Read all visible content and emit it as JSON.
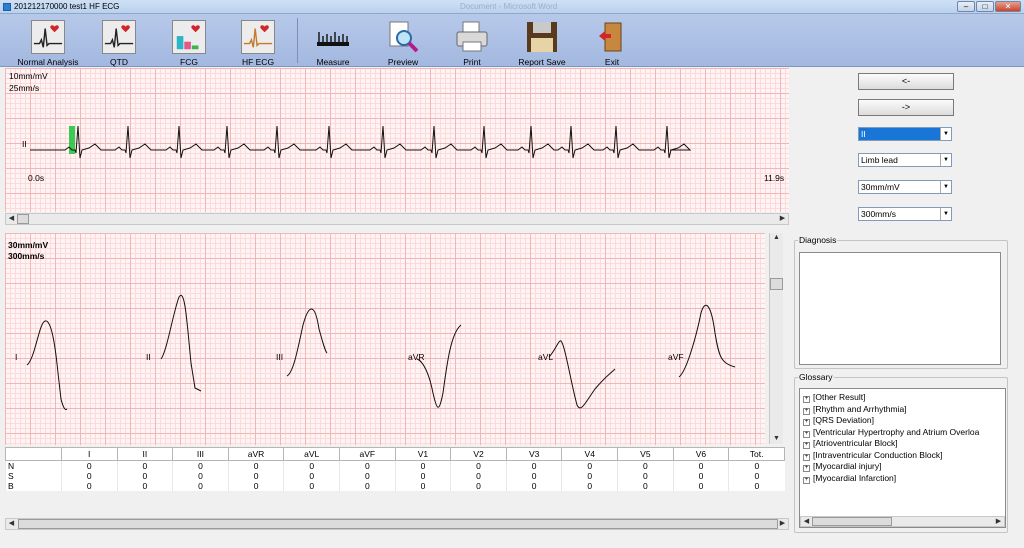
{
  "window": {
    "title": "201212170000  test1  HF ECG",
    "ghost_title": "Document - Microsoft Word",
    "controls": {
      "minimize": "–",
      "maximize": "□",
      "close": "✕"
    }
  },
  "toolbar": {
    "buttons": [
      {
        "label": "Normal Analysis",
        "icon": "ecg-heart-icon"
      },
      {
        "label": "QTD",
        "icon": "ecg-heart-icon"
      },
      {
        "label": "FCG",
        "icon": "chart-heart-icon"
      },
      {
        "label": "HF ECG",
        "icon": "ecg-heart-icon"
      },
      {
        "label": "Measure",
        "icon": "ruler-icon"
      },
      {
        "label": "Preview",
        "icon": "magnifier-icon"
      },
      {
        "label": "Print",
        "icon": "printer-icon"
      },
      {
        "label": "Report Save",
        "icon": "floppy-disk-icon"
      },
      {
        "label": "Exit",
        "icon": "exit-door-icon"
      }
    ]
  },
  "rhythm_strip": {
    "gain": "10mm/mV",
    "speed": "25mm/s",
    "lead": "II",
    "start_time": "0.0s",
    "end_time": "11.9s"
  },
  "leads_panel": {
    "gain": "30mm/mV",
    "speed": "300mm/s",
    "leads": [
      "I",
      "II",
      "III",
      "aVR",
      "aVL",
      "aVF"
    ]
  },
  "results_table": {
    "headers": [
      "",
      "I",
      "II",
      "III",
      "aVR",
      "aVL",
      "aVF",
      "V1",
      "V2",
      "V3",
      "V4",
      "V5",
      "V6",
      "Tot."
    ],
    "rows": [
      [
        "N",
        "0",
        "0",
        "0",
        "0",
        "0",
        "0",
        "0",
        "0",
        "0",
        "0",
        "0",
        "0",
        "0"
      ],
      [
        "S",
        "0",
        "0",
        "0",
        "0",
        "0",
        "0",
        "0",
        "0",
        "0",
        "0",
        "0",
        "0",
        "0"
      ],
      [
        "B",
        "0",
        "0",
        "0",
        "0",
        "0",
        "0",
        "0",
        "0",
        "0",
        "0",
        "0",
        "0",
        "0"
      ]
    ]
  },
  "controls": {
    "prev_label": "<-",
    "next_label": "->",
    "lead_select": "II",
    "lead_type_select": "Limb lead",
    "gain_select": "30mm/mV",
    "speed_select": "300mm/s",
    "dropdown_arrow": "▼"
  },
  "diagnosis": {
    "label": "Diagnosis",
    "text": ""
  },
  "glossary": {
    "label": "Glossary",
    "items": [
      "[Other Result]",
      "[Rhythm and Arrhythmia]",
      "[QRS Deviation]",
      "[Ventricular Hypertrophy and Atrium  Overloa",
      "[Atrioventricular Block]",
      "[Intraventricular Conduction Block]",
      "[Myocardial injury]",
      "[Myocardial Infarction]"
    ]
  },
  "scroll_arrows": {
    "left": "◀",
    "right": "▶",
    "up": "▲",
    "down": "▼"
  }
}
